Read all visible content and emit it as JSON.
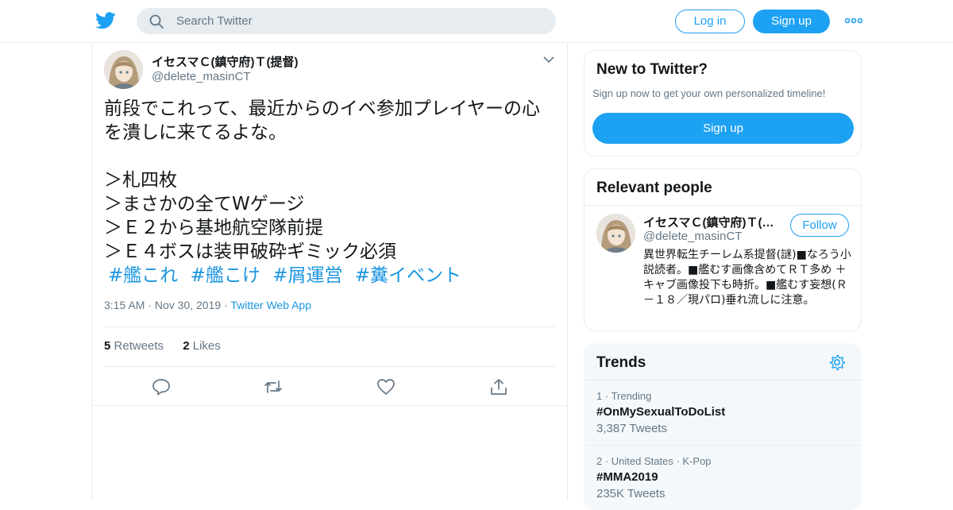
{
  "header": {
    "search_placeholder": "Search Twitter",
    "login_label": "Log in",
    "signup_label": "Sign up",
    "brand_color": "#1da1f2"
  },
  "tweet": {
    "author_name": "イセスマＣ(鎮守府)Ｔ(提督)",
    "author_handle": "@delete_masinCT",
    "text": "前段でこれって、最近からのイベ参加プレイヤーの心\nを潰しに来てるよな。\n\n＞札四枚\n＞まさかの全てWゲージ\n＞Ｅ２から基地航空隊前提\n＞Ｅ４ボスは装甲破砕ギミック必須",
    "hashtags": [
      "#艦これ",
      "#艦こけ",
      "#屑運営",
      "#糞イベント"
    ],
    "time": "3:15 AM",
    "date": "Nov 30, 2019",
    "source": "Twitter Web App",
    "retweets_count": "5",
    "retweets_label": "Retweets",
    "likes_count": "2",
    "likes_label": "Likes",
    "action_icons": [
      "reply-icon",
      "retweet-icon",
      "like-icon",
      "share-icon"
    ]
  },
  "sidebar": {
    "new_to_twitter": {
      "title": "New to Twitter?",
      "subtitle": "Sign up now to get your own personalized timeline!",
      "button": "Sign up"
    },
    "relevant_people": {
      "title": "Relevant people",
      "person": {
        "name": "イセスマＣ(鎮守府)Ｔ(…",
        "handle": "@delete_masinCT",
        "follow_label": "Follow",
        "bio": "異世界転生チーレム系提督(謎)■なろう小説読者。■艦むす画像含めてＲＴ多め ＋キャブ画像投下も時折。■艦むす妄想(Ｒ－１８／現パロ)垂れ流しに注意。"
      }
    },
    "trends": {
      "title": "Trends",
      "items": [
        {
          "rank": "1",
          "context": "Trending",
          "tag": "#OnMySexualToDoList",
          "count": "3,387 Tweets"
        },
        {
          "rank": "2",
          "context": "United States · K-Pop",
          "tag": "#MMA2019",
          "count": "235K Tweets"
        }
      ]
    }
  }
}
